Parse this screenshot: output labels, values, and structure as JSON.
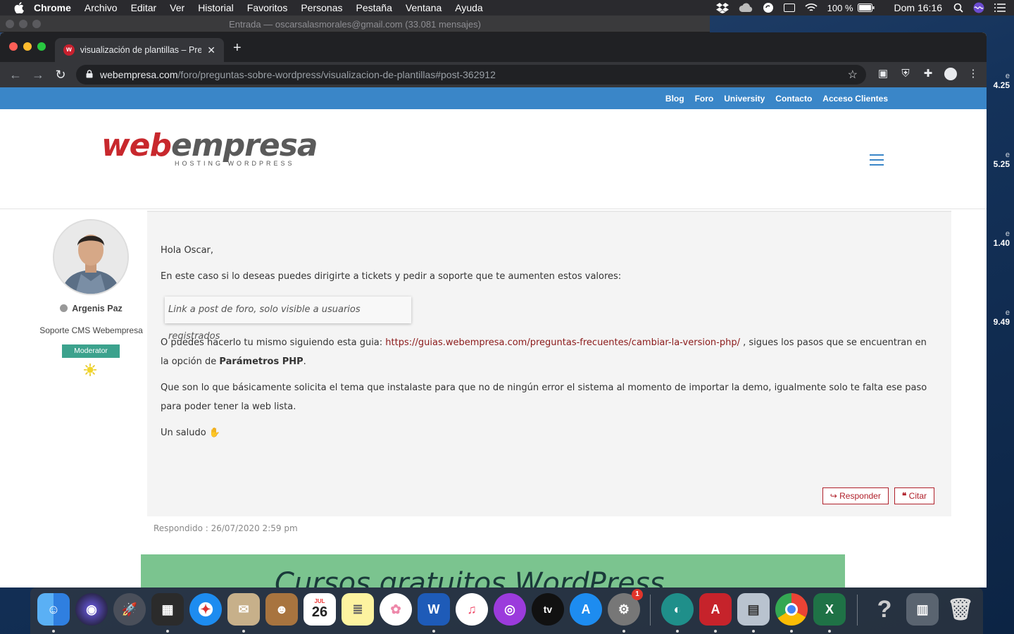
{
  "menubar": {
    "app": "Chrome",
    "items": [
      "Archivo",
      "Editar",
      "Ver",
      "Historial",
      "Favoritos",
      "Personas",
      "Pestaña",
      "Ventana",
      "Ayuda"
    ],
    "battery": "100 %",
    "clock": "Dom 16:16"
  },
  "background_window": {
    "title": "Entrada — oscarsalasmorales@gmail.com (33.081 mensajes)"
  },
  "desktop_widgets": [
    {
      "label": "e",
      "value": "4.25"
    },
    {
      "label": "e",
      "value": "5.25"
    },
    {
      "label": "e",
      "value": "1.40"
    },
    {
      "label": "e",
      "value": "9.49"
    }
  ],
  "browser": {
    "tab_title": "visualización de plantillas – Pre",
    "url_host": "webempresa.com",
    "url_path": "/foro/preguntas-sobre-wordpress/visualizacion-de-plantillas#post-362912"
  },
  "site": {
    "topnav": [
      "Blog",
      "Foro",
      "University",
      "Contacto",
      "Acceso Clientes"
    ],
    "logo_web": "web",
    "logo_empresa": "empresa",
    "logo_tagline": "HOSTING WORDPRESS"
  },
  "post": {
    "author": "Argenis Paz",
    "role": "Soporte CMS Webempresa",
    "badge": "Moderator",
    "greeting": "Hola Oscar,",
    "p1": "En este caso si lo deseas puedes dirigirte a tickets y pedir a soporte que te aumenten estos valores:",
    "restricted": "Link a post de foro, solo visible a usuarios registrados",
    "p2_before": "O puedes hacerlo tu mismo siguiendo esta guia: ",
    "p2_link": "https://guias.webempresa.com/preguntas-frecuentes/cambiar-la-version-php/",
    "p2_after": " , sigues los pasos que se encuentran en la opción de ",
    "p2_bold": "Parámetros PHP",
    "p2_end": ".",
    "p3": "Que son lo que básicamente solicita el tema que instalaste para que no de ningún error el sistema al momento de importar la demo, igualmente solo te falta ese paso para poder tener la web lista.",
    "signoff": "Un saludo",
    "reply_button": "Responder",
    "quote_button": "Citar",
    "answered": "Respondido : 26/07/2020 2:59 pm"
  },
  "banner": {
    "text": "Cursos gratuitos WordPress"
  },
  "dock": {
    "calendar_month": "JUL",
    "calendar_day": "26",
    "appletv_label": "tv",
    "settings_badge": "1"
  },
  "colors": {
    "topnav_bg": "#3a86c8",
    "brand_red": "#c8282d",
    "badge_green": "#3ca28d",
    "link": "#8b1a1a"
  }
}
